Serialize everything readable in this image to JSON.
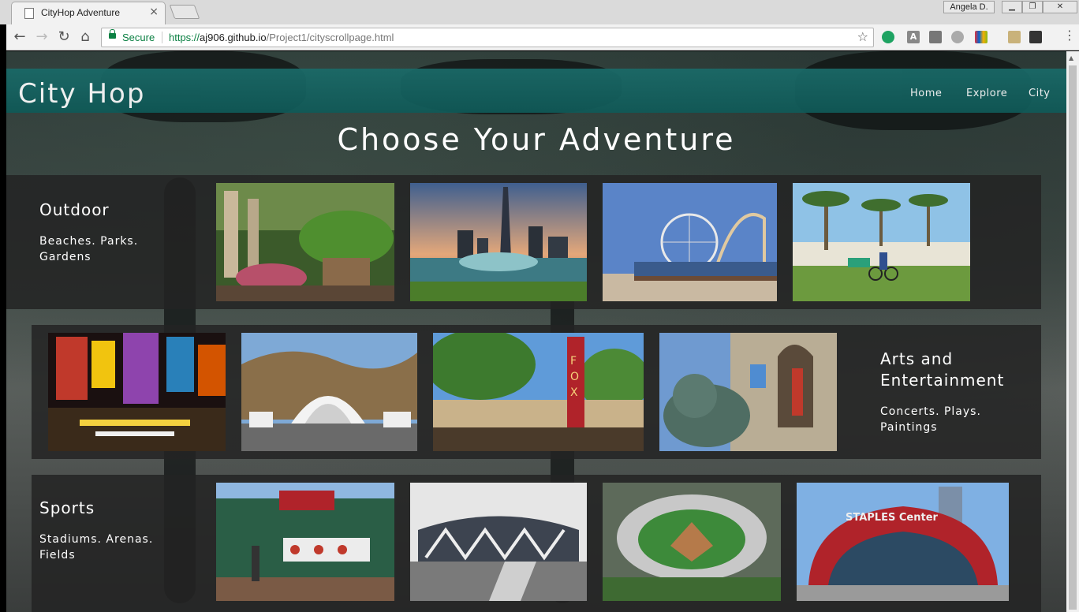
{
  "browser": {
    "tab_title": "CityHop Adventure",
    "tab_close": "×",
    "user_name": "Angela D.",
    "window_controls": [
      "▁",
      "❐",
      "✕"
    ],
    "security_label": "Secure",
    "url_scheme": "https://",
    "url_host": "aj906.github.io",
    "url_path": "/Project1/cityscrollpage.html",
    "nav_icons": [
      "back-icon",
      "forward-icon",
      "reload-icon",
      "home-icon"
    ],
    "extension_icons": [
      "green-circle-icon",
      "a-icon",
      "note-icon",
      "skype-icon",
      "ebay-icon",
      "pencil-icon",
      "menu-bars-icon"
    ]
  },
  "site": {
    "brand": "City Hop",
    "nav": [
      "Home",
      "Explore",
      "City"
    ],
    "headline": "Choose Your Adventure"
  },
  "panels": [
    {
      "title": "Outdoor",
      "description": "Beaches. Parks. Gardens",
      "images": [
        "garden-fern-pergola",
        "city-skyline-fountain",
        "santa-monica-pier",
        "beach-palm-cyclist"
      ]
    },
    {
      "title": "Arts and Entertainment",
      "description": "Concerts. Plays. Paintings",
      "images": [
        "times-square-night",
        "hollywood-bowl",
        "fox-theatre",
        "art-institute-lion"
      ]
    },
    {
      "title": "Sports",
      "description": "Stadiums. Arenas. Fields",
      "images": [
        "wrigley-field",
        "modern-arena",
        "baseball-stadium-aerial",
        "staples-center"
      ]
    }
  ],
  "colors": {
    "navbar": "#1a6b69",
    "panel": "#232323",
    "secure_green": "#0b8043"
  }
}
